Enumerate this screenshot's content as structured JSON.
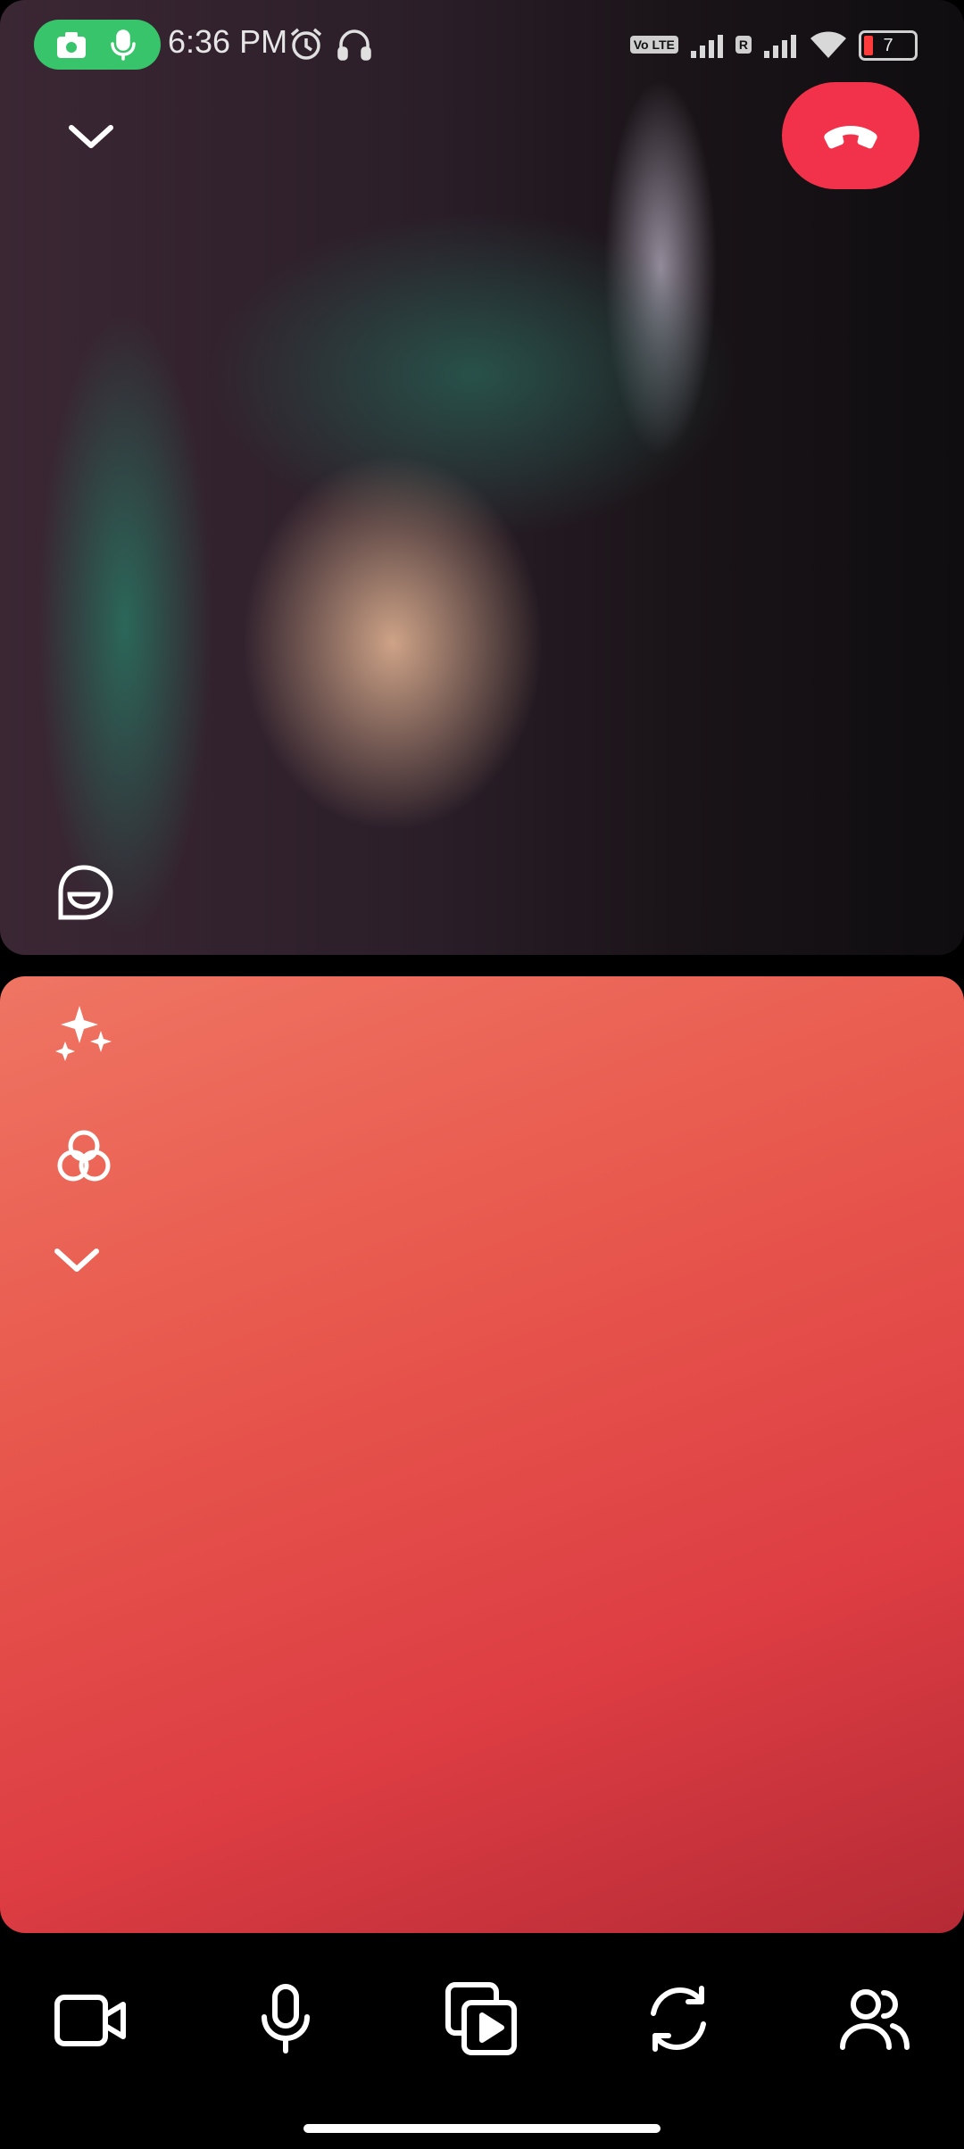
{
  "status_bar": {
    "time": "6:36 PM",
    "battery": "7",
    "net_badge_1": "Vo LTE",
    "net_badge_2": "R"
  },
  "call": {
    "remote_video_alt": "Remote participant video",
    "local_video_alt": "Your camera preview"
  },
  "controls": {
    "collapse": "collapse-chevron",
    "end_call": "end-call",
    "toolbar": [
      "video-camera",
      "microphone",
      "media-share",
      "flip-camera",
      "participants"
    ]
  },
  "colors": {
    "accent_red": "#f2324a",
    "recording_green": "#38c46a"
  }
}
